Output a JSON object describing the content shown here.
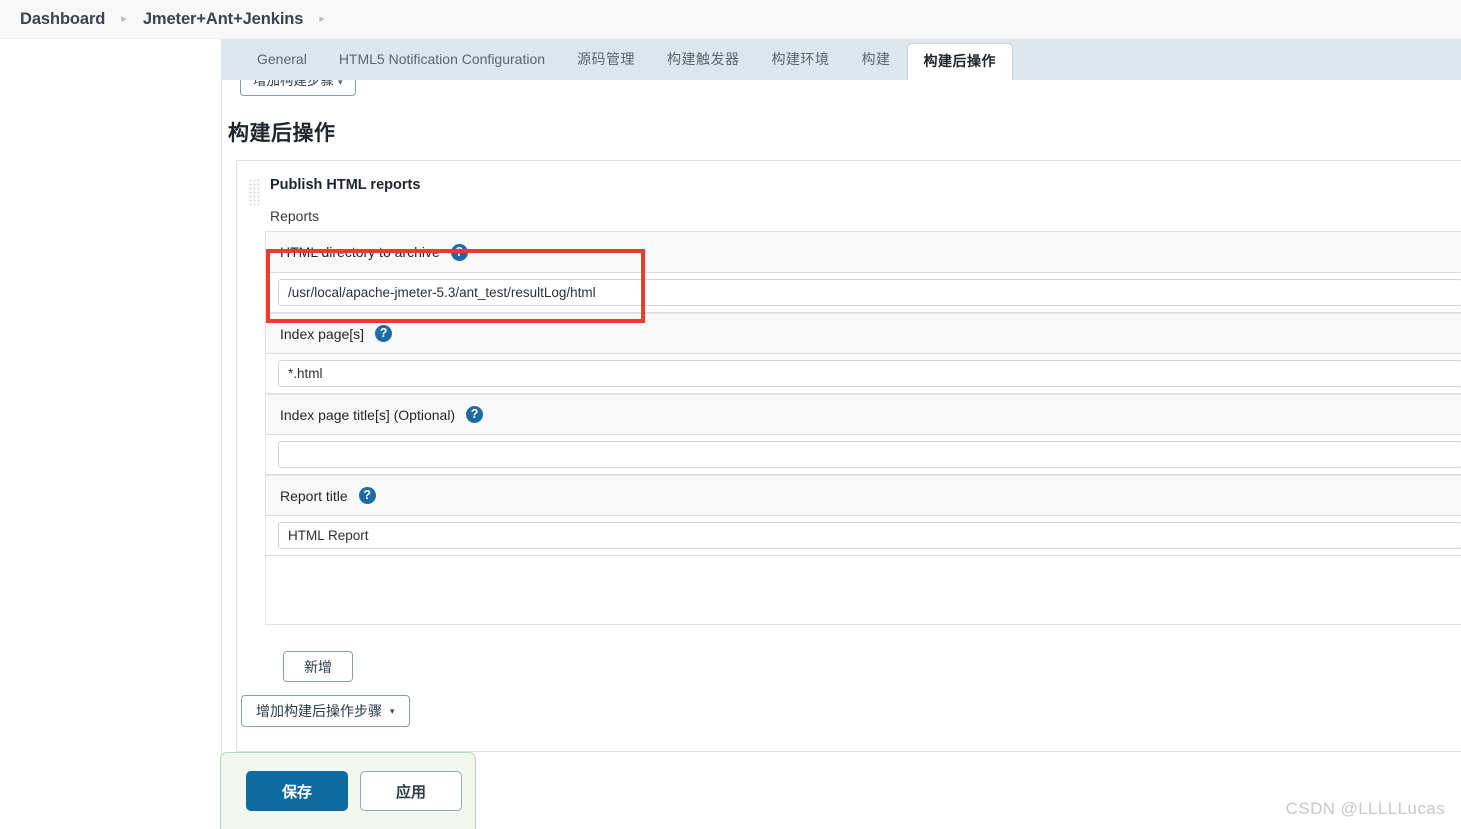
{
  "breadcrumb": {
    "items": [
      {
        "label": "Dashboard"
      },
      {
        "label": "Jmeter+Ant+Jenkins"
      }
    ],
    "separator": "▸"
  },
  "tabs": [
    {
      "label": "General",
      "active": false
    },
    {
      "label": "HTML5 Notification Configuration",
      "active": false
    },
    {
      "label": "源码管理",
      "active": false
    },
    {
      "label": "构建触发器",
      "active": false
    },
    {
      "label": "构建环境",
      "active": false
    },
    {
      "label": "构建",
      "active": false
    },
    {
      "label": "构建后操作",
      "active": true
    }
  ],
  "clipped_build_step_button": {
    "label": "增加构建步骤",
    "caret": "▾"
  },
  "main": {
    "section_title": "构建后操作",
    "publisher": {
      "grip_icon": "drag-grip-icon",
      "heading": "Publish HTML reports",
      "reports_label": "Reports",
      "fields": [
        {
          "label": "HTML directory to archive",
          "help_icon": "help-icon",
          "help_glyph": "?",
          "value": "/usr/local/apache-jmeter-5.3/ant_test/resultLog/html",
          "placeholder": "",
          "highlighted": true
        },
        {
          "label": "Index page[s]",
          "help_icon": "help-icon",
          "help_glyph": "?",
          "value": "*.html",
          "placeholder": "",
          "highlighted": false
        },
        {
          "label": "Index page title[s] (Optional)",
          "help_icon": "help-icon",
          "help_glyph": "?",
          "value": "",
          "placeholder": "",
          "highlighted": false
        },
        {
          "label": "Report title",
          "help_icon": "help-icon",
          "help_glyph": "?",
          "value": "HTML Report",
          "placeholder": "",
          "highlighted": false
        }
      ],
      "add_report_button": "新增"
    },
    "add_postbuild_button": {
      "label": "增加构建后操作步骤",
      "caret": "▾"
    }
  },
  "sticky_bar": {
    "save_label": "保存",
    "apply_label": "应用"
  },
  "watermark": "CSDN @LLLLLucas",
  "colors": {
    "accent_blue": "#0e6ba1",
    "help_blue": "#1f6ba5",
    "highlight_red": "#ef3b2d",
    "tabbar_bg": "#dde6ec",
    "sticky_bg": "#f2f7f0",
    "sticky_border": "#bcd6c2"
  }
}
